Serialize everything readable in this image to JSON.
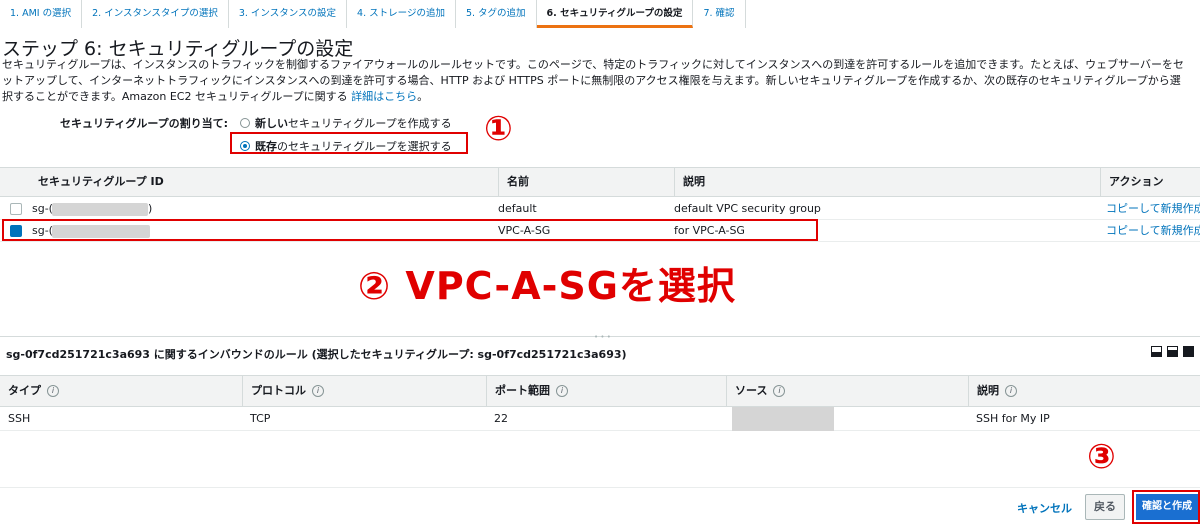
{
  "tabs": [
    "1. AMI の選択",
    "2. インスタンスタイプの選択",
    "3. インスタンスの設定",
    "4. ストレージの追加",
    "5. タグの追加",
    "6. セキュリティグループの設定",
    "7. 確認"
  ],
  "title": "ステップ 6: セキュリティグループの設定",
  "description": {
    "line1": "セキュリティグループは、インスタンスのトラフィックを制御するファイアウォールのルールセットです。このページで、特定のトラフィックに対してインスタンスへの到達を許可するルールを追加できます。たとえば、ウェブサーバーをセ",
    "line2": "ットアップして、インターネットトラフィックにインスタンスへの到達を許可する場合、HTTP および HTTPS ポートに無制限のアクセス権限を与えます。新しいセキュリティグループを作成するか、次の既存のセキュリティグループから選",
    "line3": "択することができます。Amazon EC2 セキュリティグループに関する ",
    "link": "詳細はこちら",
    "line3_end": "。"
  },
  "assign": {
    "label": "セキュリティグループの割り当て:",
    "new_bold": "新しい",
    "new_rest": "セキュリティグループを作成する",
    "existing_bold": "既存",
    "existing_rest": "のセキュリティグループを選択する"
  },
  "annotations": {
    "one": "①",
    "two": "② VPC-A-SGを選択",
    "three": "③"
  },
  "sg_table": {
    "columns": [
      "セキュリティグループ ID",
      "名前",
      "説明",
      "アクション"
    ],
    "rows": [
      {
        "id": "sg-(",
        "id_tail": ")",
        "name": "default",
        "desc": "default VPC security group",
        "action": "コピーして新規作成",
        "checked": false
      },
      {
        "id": "sg-(",
        "id_tail": "",
        "name": "VPC-A-SG",
        "desc": "for VPC-A-SG",
        "action": "コピーして新規作成",
        "checked": true
      }
    ]
  },
  "rules": {
    "title": "sg-0f7cd251721c3a693 に関するインバウンドのルール (選択したセキュリティグループ: sg-0f7cd251721c3a693)",
    "columns": [
      "タイプ",
      "プロトコル",
      "ポート範囲",
      "ソース",
      "説明"
    ],
    "info_glyph": "i",
    "row": {
      "type": "SSH",
      "protocol": "TCP",
      "port": "22",
      "source": "",
      "desc": "SSH for My IP"
    }
  },
  "footer": {
    "cancel": "キャンセル",
    "back": "戻る",
    "create": "確認と作成"
  }
}
